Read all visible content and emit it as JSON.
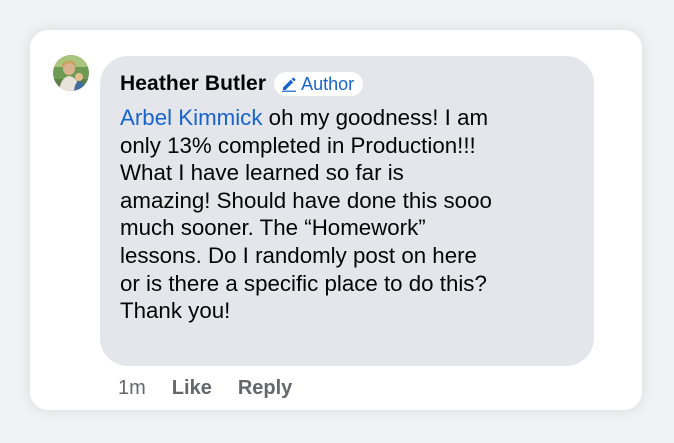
{
  "comment": {
    "author": "Heather Butler",
    "badge": {
      "label": "Author",
      "icon": "pencil-icon"
    },
    "mention": "Arbel Kimmick",
    "text_line1_rest": " oh my goodness! I am",
    "text_rest": "only 13% completed in Production!!!\nWhat I have learned so far is\namazing! Should have done this sooo\nmuch sooner.  The “Homework”\nlessons. Do I randomly post on here\nor is there a specific place to do this?\nThank you!",
    "timestamp": "1m",
    "like_label": "Like",
    "reply_label": "Reply"
  },
  "colors": {
    "bubble": "#e4e6eb",
    "link": "#1763cf",
    "meta": "#65676b",
    "text": "#050505"
  }
}
